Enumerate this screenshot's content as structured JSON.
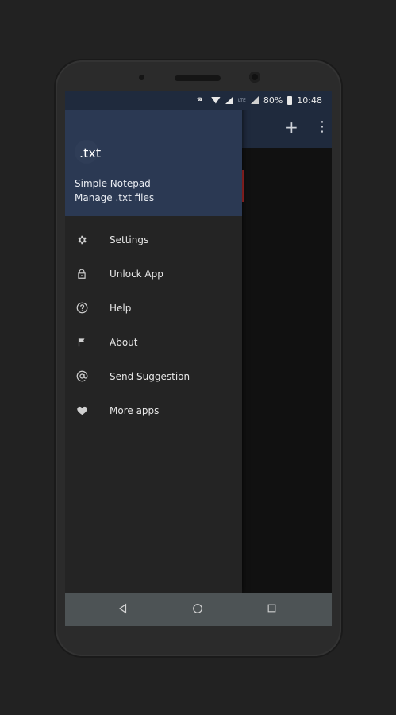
{
  "status_bar": {
    "battery": "80%",
    "time": "10:48",
    "lte_label": "LTE"
  },
  "app_bar": {
    "add_icon": "plus-icon",
    "overflow_icon": "more-vert-icon"
  },
  "drawer": {
    "logo_text": ".txt",
    "app_name": "Simple Notepad",
    "app_subtitle": "Manage .txt files",
    "items": [
      {
        "label": "Settings",
        "icon": "gear-icon"
      },
      {
        "label": "Unlock App",
        "icon": "lock-icon"
      },
      {
        "label": "Help",
        "icon": "help-icon"
      },
      {
        "label": "About",
        "icon": "flag-icon"
      },
      {
        "label": "Send Suggestion",
        "icon": "at-icon"
      },
      {
        "label": "More apps",
        "icon": "heart-icon"
      }
    ]
  },
  "nav_bar": {
    "back": "back-icon",
    "home": "home-icon",
    "recents": "recents-icon"
  },
  "colors": {
    "drawer_header": "#2b3953",
    "drawer_bg": "#242424",
    "nav_bar": "#4d5355"
  }
}
